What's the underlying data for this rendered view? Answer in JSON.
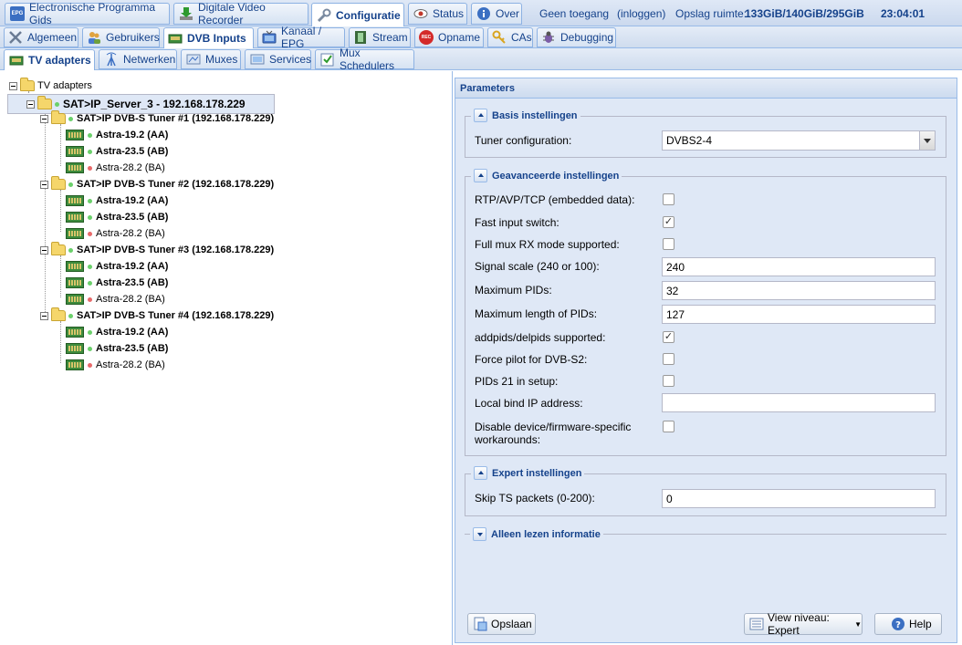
{
  "top_tabs": [
    {
      "label": "Electronische Programma Gids",
      "icon": "epg-icon"
    },
    {
      "label": "Digitale Video Recorder",
      "icon": "download-icon"
    },
    {
      "label": "Configuratie",
      "icon": "wrench-icon"
    },
    {
      "label": "Status",
      "icon": "eye-icon"
    },
    {
      "label": "Over",
      "icon": "info-icon"
    }
  ],
  "top_status": {
    "access": "Geen toegang",
    "login": "(inloggen)",
    "storage_label": "Opslag ruimte:",
    "storage_value": "133GiB/140GiB/295GiB",
    "time": "23:04:01"
  },
  "epg_icon_text": "EPG",
  "config_tabs": [
    {
      "label": "Algemeen",
      "icon": "tools-icon"
    },
    {
      "label": "Gebruikers",
      "icon": "users-icon"
    },
    {
      "label": "DVB Inputs",
      "icon": "card-icon"
    },
    {
      "label": "Kanaal / EPG",
      "icon": "tv-icon"
    },
    {
      "label": "Stream",
      "icon": "film-icon"
    },
    {
      "label": "Opname",
      "icon": "rec-icon"
    },
    {
      "label": "CAs",
      "icon": "key-icon"
    },
    {
      "label": "Debugging",
      "icon": "bug-icon"
    }
  ],
  "rec_icon_text": "REC",
  "dvb_tabs": [
    {
      "label": "TV adapters",
      "icon": "card-icon"
    },
    {
      "label": "Netwerken",
      "icon": "antenna-icon"
    },
    {
      "label": "Muxes",
      "icon": "mux-icon"
    },
    {
      "label": "Services",
      "icon": "services-icon"
    },
    {
      "label": "Mux Schedulers",
      "icon": "scheduler-icon"
    }
  ],
  "tree": {
    "root": "TV adapters",
    "server": "SAT>IP_Server_3 - 192.168.178.229",
    "tuners": [
      {
        "label": "SAT>IP DVB-S Tuner #1 (192.168.178.229)",
        "sats": [
          "Astra-19.2 (AA)",
          "Astra-23.5 (AB)",
          "Astra-28.2 (BA)"
        ]
      },
      {
        "label": "SAT>IP DVB-S Tuner #2 (192.168.178.229)",
        "sats": [
          "Astra-19.2 (AA)",
          "Astra-23.5 (AB)",
          "Astra-28.2 (BA)"
        ]
      },
      {
        "label": "SAT>IP DVB-S Tuner #3 (192.168.178.229)",
        "sats": [
          "Astra-19.2 (AA)",
          "Astra-23.5 (AB)",
          "Astra-28.2 (BA)"
        ]
      },
      {
        "label": "SAT>IP DVB-S Tuner #4 (192.168.178.229)",
        "sats": [
          "Astra-19.2 (AA)",
          "Astra-23.5 (AB)",
          "Astra-28.2 (BA)"
        ]
      }
    ]
  },
  "params": {
    "title": "Parameters",
    "basic": {
      "legend": "Basis instellingen",
      "tuner_config_label": "Tuner configuration:",
      "tuner_config_value": "DVBS2-4"
    },
    "advanced": {
      "legend": "Geavanceerde instellingen",
      "rtp_label": "RTP/AVP/TCP (embedded data):",
      "rtp_checked": false,
      "fast_input_label": "Fast input switch:",
      "fast_input_checked": true,
      "full_mux_label": "Full mux RX mode supported:",
      "full_mux_checked": false,
      "signal_scale_label": "Signal scale (240 or 100):",
      "signal_scale_value": "240",
      "max_pids_label": "Maximum PIDs:",
      "max_pids_value": "32",
      "max_len_pids_label": "Maximum length of PIDs:",
      "max_len_pids_value": "127",
      "addpids_label": "addpids/delpids supported:",
      "addpids_checked": true,
      "force_pilot_label": "Force pilot for DVB-S2:",
      "force_pilot_checked": false,
      "pids21_label": "PIDs 21 in setup:",
      "pids21_checked": false,
      "local_bind_label": "Local bind IP address:",
      "local_bind_value": "",
      "disable_fw_label_1": "Disable device/firmware-specific",
      "disable_fw_label_2": "workarounds:",
      "disable_fw_checked": false
    },
    "expert": {
      "legend": "Expert instellingen",
      "skip_ts_label": "Skip TS packets (0-200):",
      "skip_ts_value": "0"
    },
    "readonly": {
      "legend": "Alleen lezen informatie"
    }
  },
  "buttons": {
    "save": "Opslaan",
    "view_level": "View niveau: Expert",
    "help": "Help"
  }
}
